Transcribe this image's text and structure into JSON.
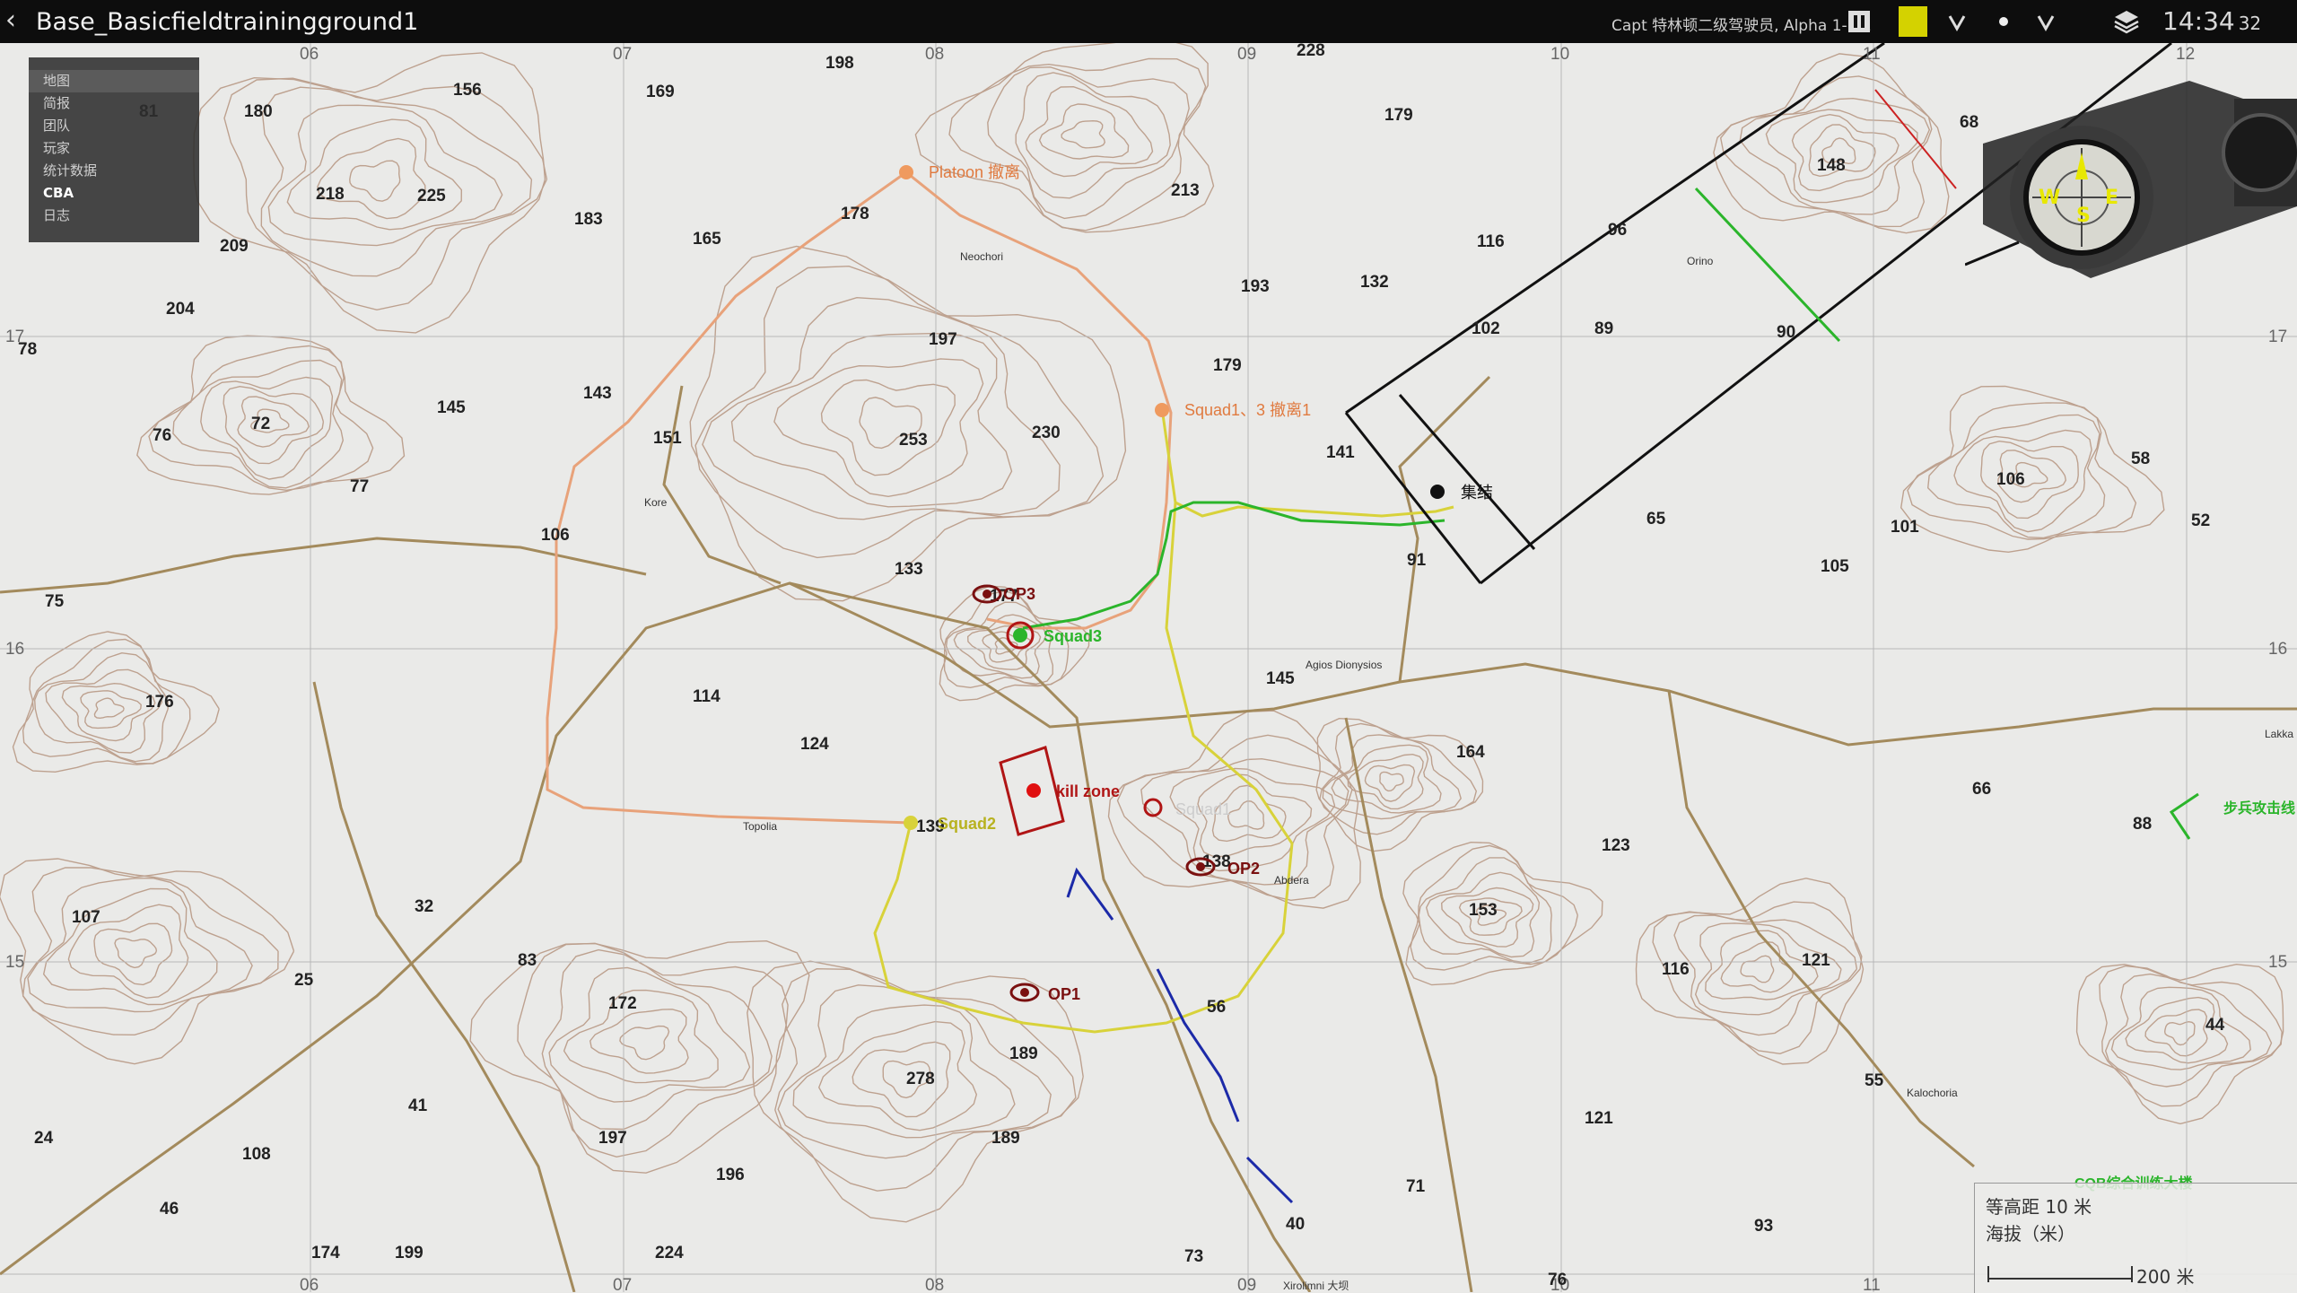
{
  "topbar": {
    "title": "Base_Basicfieldtrainingground1",
    "player": "Capt 特林顿二级驾驶员, Alpha 1-1 1",
    "clock_main": "14:34",
    "clock_seconds": "32",
    "marker_color": "#d4d200"
  },
  "menu": {
    "items": [
      "地图",
      "简报",
      "团队",
      "玩家",
      "统计数据",
      "CBA",
      "日志"
    ]
  },
  "grid": {
    "top_labels": [
      "06",
      "07",
      "08",
      "09",
      "10",
      "11",
      "12"
    ],
    "bottom_labels": [
      "06",
      "07",
      "08",
      "09",
      "10",
      "11"
    ],
    "left_labels": [
      "17",
      "16",
      "15"
    ],
    "right_labels": [
      "17",
      "16",
      "15"
    ]
  },
  "markers": {
    "platoon": "Platoon 撤离",
    "squad1_3": "Squad1、3 撤离1",
    "squad3": "Squad3",
    "squad2": "Squad2",
    "squad1": "Squad1",
    "op3": "OP3",
    "op2": "OP2",
    "op1": "OP1",
    "kill_zone": "kill zone",
    "assembly": "集结",
    "infantry_attack": "步兵攻击线",
    "cqb": "CQB综合训练大楼"
  },
  "towns": [
    "Kore",
    "Agios Dionysios",
    "Neochori",
    "Topolia",
    "Orino",
    "Kalochoria",
    "Lakka",
    "Abdera",
    "Xirolimni 大坝"
  ],
  "elevations": [
    "198",
    "169",
    "156",
    "180",
    "81",
    "225",
    "218",
    "183",
    "209",
    "165",
    "178",
    "204",
    "78",
    "145",
    "143",
    "76",
    "72",
    "77",
    "151",
    "106",
    "75",
    "176",
    "114",
    "124",
    "107",
    "32",
    "25",
    "83",
    "172",
    "41",
    "24",
    "108",
    "197",
    "196",
    "46",
    "174",
    "199",
    "224",
    "253",
    "230",
    "197",
    "213",
    "193",
    "179",
    "228",
    "179",
    "116",
    "132",
    "96",
    "68",
    "148",
    "102",
    "89",
    "90",
    "141",
    "65",
    "91",
    "106",
    "101",
    "105",
    "58",
    "52",
    "133",
    "177",
    "145",
    "164",
    "139",
    "138",
    "123",
    "153",
    "116",
    "121",
    "88",
    "66",
    "56",
    "189",
    "278",
    "189",
    "40",
    "73",
    "71",
    "121",
    "93",
    "55",
    "44",
    "76"
  ],
  "scale": {
    "contour_label": "等高距 10 米",
    "altitude_label": "海拔（米）",
    "distance_label": "200 米"
  }
}
